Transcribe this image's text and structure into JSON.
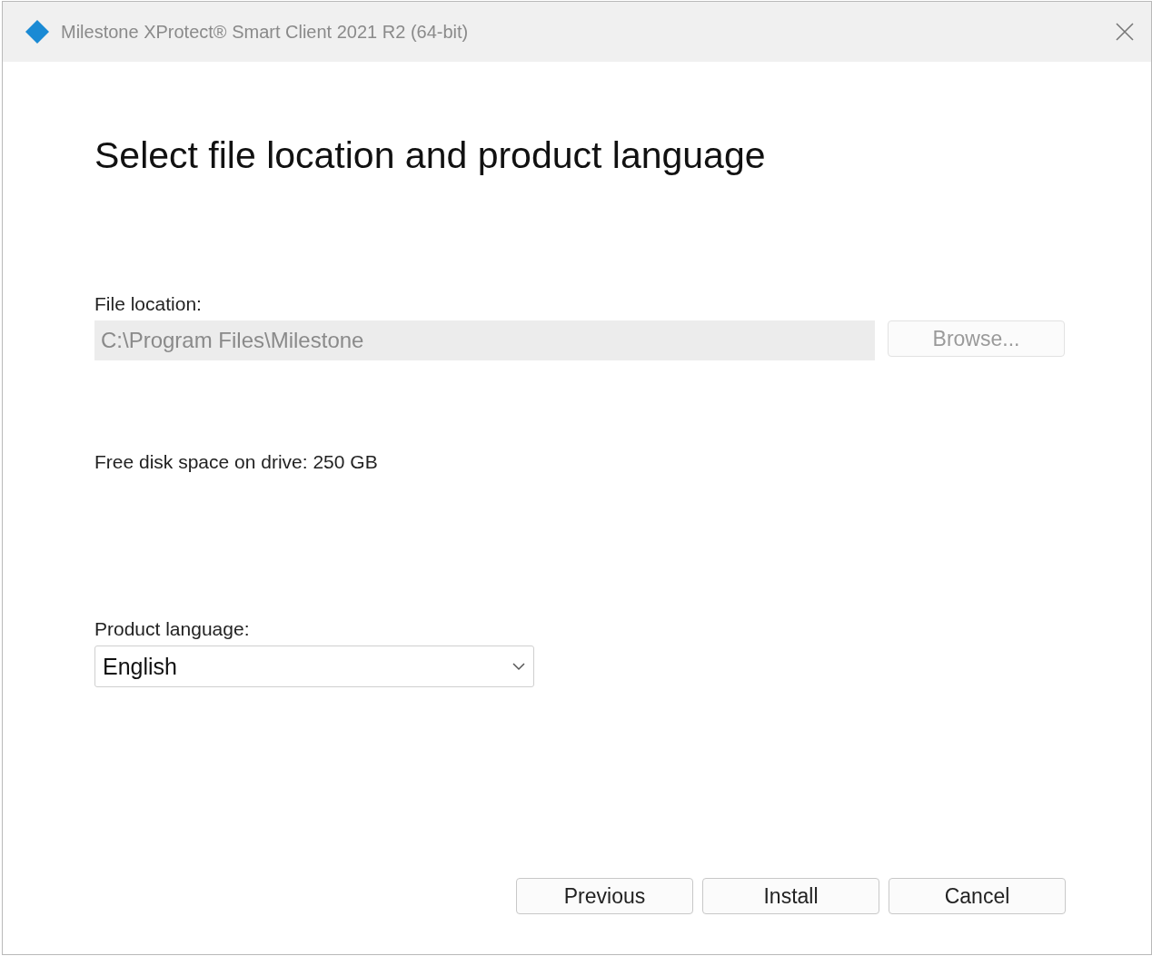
{
  "window": {
    "title": "Milestone XProtect® Smart Client 2021 R2 (64-bit)"
  },
  "heading": "Select file location and product language",
  "file_location": {
    "label": "File location:",
    "value": "C:\\Program Files\\Milestone",
    "disabled": true,
    "browse": {
      "label": "Browse...",
      "disabled": true
    }
  },
  "free_space": "Free disk space on drive: 250 GB",
  "language": {
    "label": "Product language:",
    "value": "English"
  },
  "buttons": [
    "Previous",
    "Install",
    "Cancel"
  ]
}
